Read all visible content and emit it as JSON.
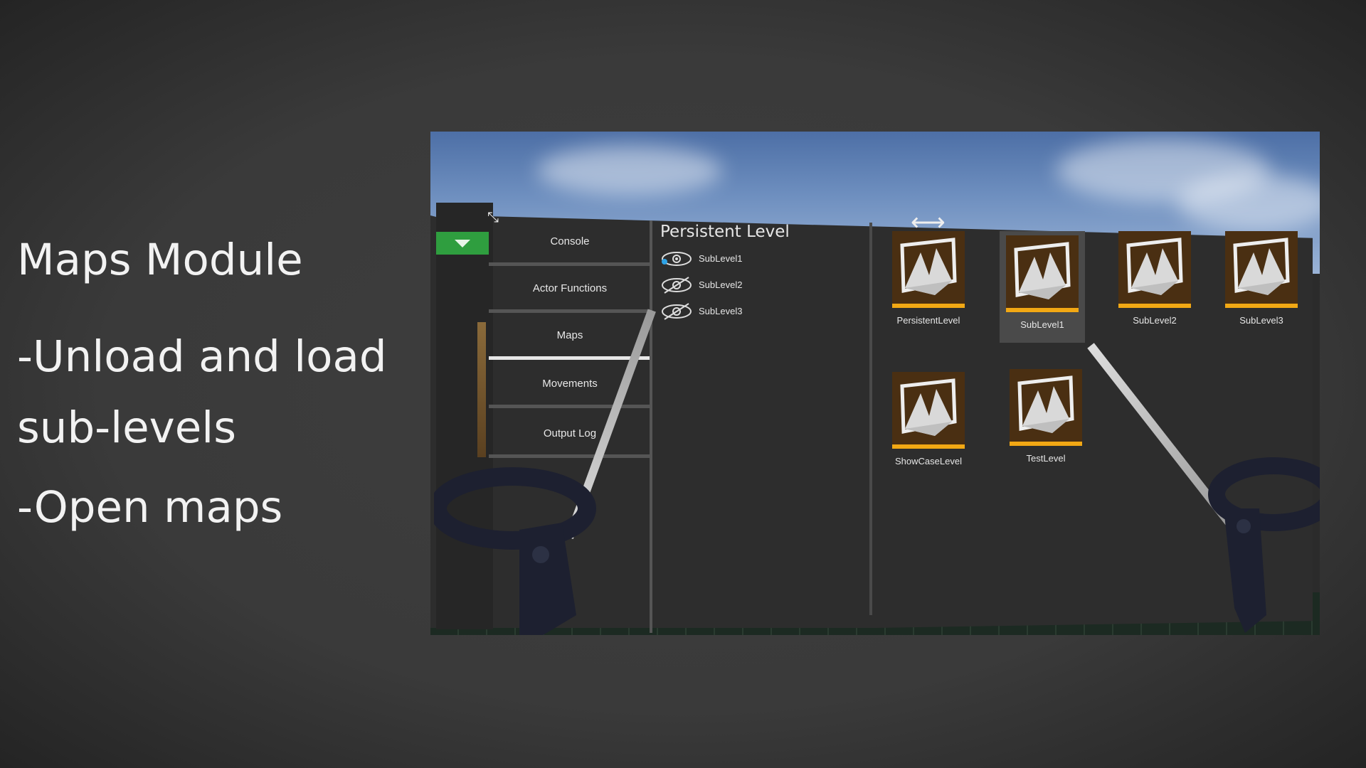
{
  "slide": {
    "title": "Maps Module",
    "bullet1": "-Unload and load sub-levels",
    "bullet2": "-Open maps"
  },
  "menu": {
    "items": [
      {
        "label": "Console",
        "active": false
      },
      {
        "label": "Actor Functions",
        "active": false
      },
      {
        "label": "Maps",
        "active": true
      },
      {
        "label": "Movements",
        "active": false
      },
      {
        "label": "Output Log",
        "active": false
      }
    ]
  },
  "levels_panel": {
    "title": "Persistent Level",
    "sublevels": [
      {
        "name": "SubLevel1",
        "visible": true
      },
      {
        "name": "SubLevel2",
        "visible": false
      },
      {
        "name": "SubLevel3",
        "visible": false
      }
    ]
  },
  "maps": [
    {
      "name": "PersistentLevel",
      "selected": false
    },
    {
      "name": "SubLevel1",
      "selected": true
    },
    {
      "name": "SubLevel2",
      "selected": false
    },
    {
      "name": "SubLevel3",
      "selected": false
    },
    {
      "name": "ShowCaseLevel",
      "selected": false
    },
    {
      "name": "TestLevel",
      "selected": false
    }
  ],
  "colors": {
    "accent_green": "#2f9e3f",
    "map_bar": "#f2a814",
    "thumb_bg": "#4a2f12"
  },
  "icons": {
    "dropdown": "chevron-down-icon",
    "visible": "eye-icon",
    "hidden": "eye-slash-icon",
    "resize_horizontal": "resize-horizontal-icon",
    "resize_diagonal": "resize-diagonal-icon"
  }
}
